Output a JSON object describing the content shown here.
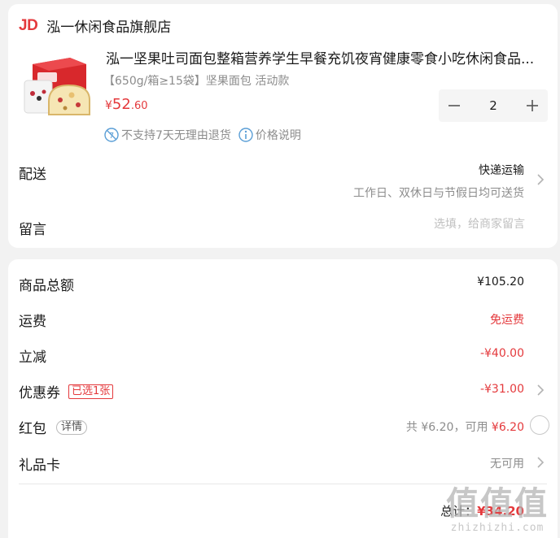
{
  "shop": {
    "logo": "JD",
    "name": "泓一休闲食品旗舰店"
  },
  "product": {
    "image_icon": "bread-product-image",
    "title": "泓一坚果吐司面包整箱营养学生早餐充饥夜宵健康零食小吃休闲食品...",
    "spec": "【650g/箱≥15袋】坚果面包 活动款",
    "price_currency": "¥",
    "price_int": "52",
    "price_dec": ".60",
    "quantity": "2",
    "tags": [
      "不支持7天无理由退货",
      "价格说明"
    ]
  },
  "delivery": {
    "label": "配送",
    "method": "快递运输",
    "note": "工作日、双休日与节假日均可送货"
  },
  "message": {
    "label": "留言",
    "placeholder": "选填，给商家留言"
  },
  "summary": {
    "items": [
      {
        "label": "商品总额",
        "value": "¥105.20"
      },
      {
        "label": "运费",
        "value": "免运费"
      },
      {
        "label": "立减",
        "value": "-¥40.00"
      },
      {
        "label": "优惠券",
        "badge": "已选1张",
        "value": "-¥31.00"
      },
      {
        "label": "红包",
        "badge": "详情",
        "value_prefix": "共 ¥6.20，可用 ",
        "value_highlight": "¥6.20"
      },
      {
        "label": "礼品卡",
        "value": "无可用"
      }
    ],
    "total_label": "总计：",
    "total_value": "¥34.20"
  },
  "watermark": {
    "big": "值值值",
    "small": "zhizhizhi.com"
  },
  "colors": {
    "accent": "#e4393c",
    "text": "#1a1a1a",
    "muted": "#8c8c8c",
    "background": "#f2f2f2"
  }
}
